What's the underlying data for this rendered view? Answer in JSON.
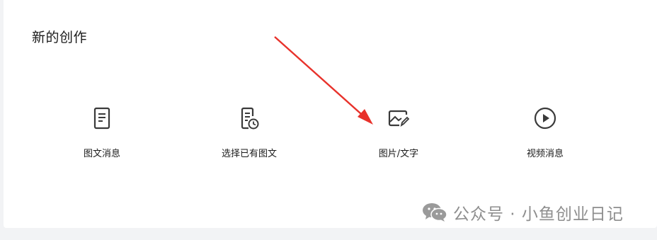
{
  "section": {
    "title": "新的创作"
  },
  "options": [
    {
      "label": "图文消息",
      "icon": "document-icon"
    },
    {
      "label": "选择已有图文",
      "icon": "document-clock-icon"
    },
    {
      "label": "图片/文字",
      "icon": "image-edit-icon"
    },
    {
      "label": "视频消息",
      "icon": "play-circle-icon"
    }
  ],
  "watermark": {
    "text": "公众号 · 小鱼创业日记",
    "icon": "wechat-icon"
  },
  "colors": {
    "icon": "#3a3a3a",
    "arrow": "#e8322b",
    "watermark": "#8e8e8e"
  }
}
